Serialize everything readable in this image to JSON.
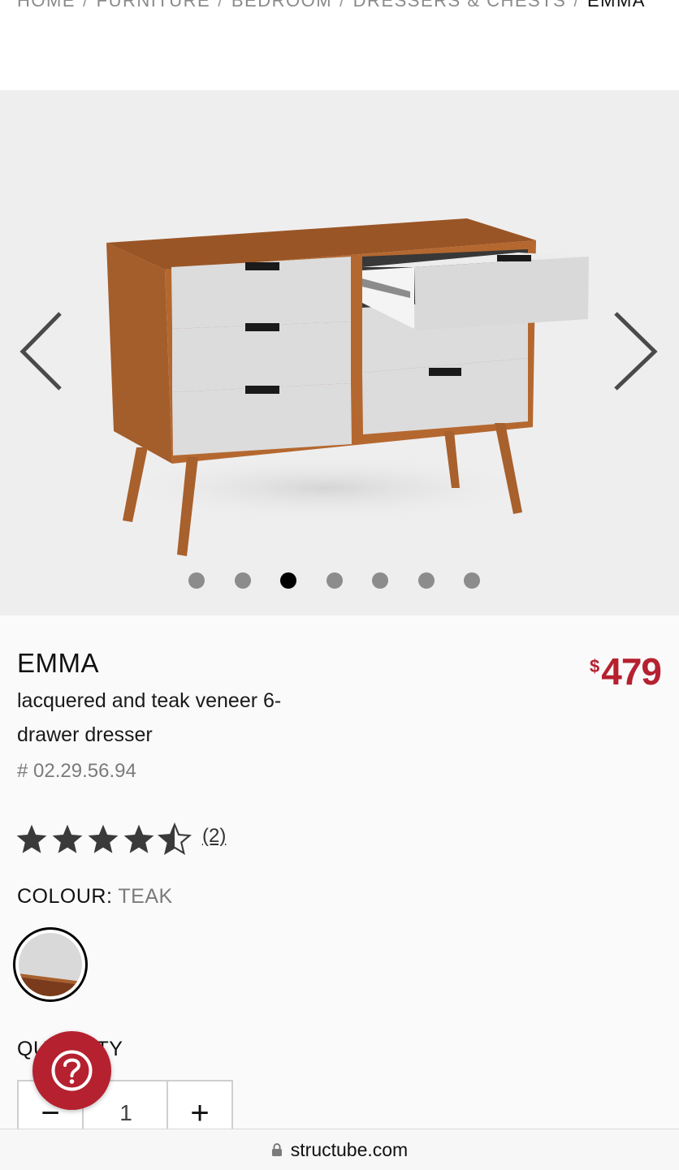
{
  "breadcrumb": {
    "items": [
      "HOME",
      "FURNITURE",
      "BEDROOM",
      "DRESSERS & CHESTS"
    ],
    "current": "EMMA",
    "separator": "/"
  },
  "gallery": {
    "image_count": 7,
    "active_index": 2,
    "prev_icon": "chevron-left-icon",
    "next_icon": "chevron-right-icon"
  },
  "product": {
    "name": "EMMA",
    "description": "lacquered and teak veneer 6-drawer dresser",
    "sku": "# 02.29.56.94",
    "price_currency": "$",
    "price_amount": "479",
    "price_color": "#b5212f",
    "rating": 4.5,
    "rating_max": 5,
    "review_count": "(2)"
  },
  "colour": {
    "label": "COLOUR:",
    "value": "TEAK"
  },
  "quantity": {
    "label": "QUANTITY",
    "value": "1",
    "minus_label": "−",
    "plus_label": "+"
  },
  "help": {
    "icon": "question-icon"
  },
  "browser": {
    "url": "structube.com",
    "lock_icon": "lock-icon"
  }
}
